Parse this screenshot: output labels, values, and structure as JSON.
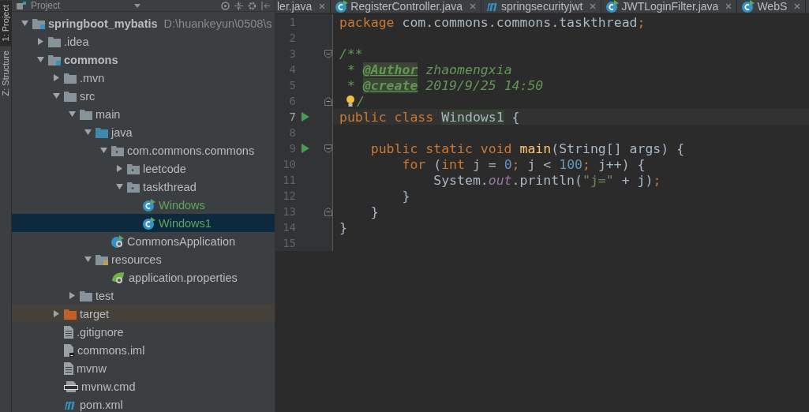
{
  "side_strip": [
    {
      "label": "1: Project",
      "selected": true
    },
    {
      "label": "Z: Structure",
      "selected": false
    }
  ],
  "project_panel": {
    "title": "Project",
    "tree": [
      {
        "label": "springboot_mybatis",
        "path": "D:\\huankeyun\\0508\\s",
        "kind": "module",
        "expanded": true,
        "selected": false,
        "color": "#bbbbbb",
        "children": [
          {
            "label": ".idea",
            "kind": "folder",
            "expanded": false,
            "selected": false,
            "color": "#bbbbbb"
          },
          {
            "label": "commons",
            "kind": "module",
            "expanded": true,
            "selected": false,
            "color": "#bbbbbb",
            "children": [
              {
                "label": ".mvn",
                "kind": "folder",
                "expanded": false,
                "selected": false,
                "color": "#bbbbbb"
              },
              {
                "label": "src",
                "kind": "folder",
                "expanded": true,
                "selected": false,
                "color": "#bbbbbb",
                "children": [
                  {
                    "label": "main",
                    "kind": "folder",
                    "expanded": true,
                    "selected": false,
                    "color": "#bbbbbb",
                    "children": [
                      {
                        "label": "java",
                        "kind": "source",
                        "expanded": true,
                        "selected": false,
                        "color": "#bbbbbb",
                        "children": [
                          {
                            "label": "com.commons.commons",
                            "kind": "package",
                            "expanded": true,
                            "selected": false,
                            "color": "#bbbbbb",
                            "children": [
                              {
                                "label": "leetcode",
                                "kind": "package",
                                "expanded": false,
                                "selected": false,
                                "color": "#bbbbbb"
                              },
                              {
                                "label": "taskthread",
                                "kind": "package",
                                "expanded": true,
                                "selected": false,
                                "color": "#bbbbbb",
                                "children": [
                                  {
                                    "label": "Windows",
                                    "kind": "class",
                                    "selected": false,
                                    "color": "#62a55c"
                                  },
                                  {
                                    "label": "Windows1",
                                    "kind": "class",
                                    "selected": true,
                                    "color": "#62a55c"
                                  }
                                ]
                              }
                            ]
                          },
                          {
                            "label": "CommonsApplication",
                            "kind": "springclass",
                            "selected": false,
                            "color": "#bbbbbb"
                          }
                        ]
                      },
                      {
                        "label": "resources",
                        "kind": "resources",
                        "expanded": true,
                        "selected": false,
                        "color": "#bbbbbb",
                        "children": [
                          {
                            "label": "application.properties",
                            "kind": "springfile",
                            "selected": false,
                            "color": "#bbbbbb"
                          }
                        ]
                      }
                    ]
                  },
                  {
                    "label": "test",
                    "kind": "folder",
                    "expanded": false,
                    "selected": false,
                    "color": "#bbbbbb"
                  }
                ]
              },
              {
                "label": "target",
                "kind": "excluded",
                "expanded": false,
                "selected": false,
                "color": "#bbbbbb"
              },
              {
                "label": ".gitignore",
                "kind": "file",
                "selected": false,
                "color": "#bbbbbb"
              },
              {
                "label": "commons.iml",
                "kind": "iml",
                "selected": false,
                "color": "#bbbbbb"
              },
              {
                "label": "mvnw",
                "kind": "file",
                "selected": false,
                "color": "#bbbbbb"
              },
              {
                "label": "mvnw.cmd",
                "kind": "cmd",
                "selected": false,
                "color": "#bbbbbb"
              },
              {
                "label": "pom.xml",
                "kind": "maven",
                "selected": false,
                "color": "#bbbbbb"
              }
            ]
          }
        ]
      }
    ]
  },
  "editor": {
    "tabs": [
      {
        "label": "ler.java",
        "kind": "plain",
        "selected": false
      },
      {
        "label": "RegisterController.java",
        "kind": "class",
        "selected": false
      },
      {
        "label": "springsecurityjwt",
        "kind": "maven",
        "selected": false
      },
      {
        "label": "JWTLoginFilter.java",
        "kind": "class",
        "selected": false
      },
      {
        "label": "WebS",
        "kind": "class",
        "selected": false
      }
    ],
    "lines": [
      {
        "number": "1",
        "run": false,
        "fold_start": false,
        "fold_end": false,
        "bulb": false,
        "current": false,
        "tokens": [
          {
            "kind": "keyword",
            "text": "package "
          },
          {
            "kind": "plain",
            "text": "com.commons.commons.taskthread"
          },
          {
            "kind": "keyword",
            "text": ";"
          }
        ]
      },
      {
        "number": "2",
        "run": false,
        "fold_start": false,
        "fold_end": false,
        "bulb": false,
        "current": false
      },
      {
        "number": "3",
        "run": false,
        "fold_start": true,
        "fold_end": false,
        "bulb": false,
        "current": false,
        "tokens": [
          {
            "kind": "comment",
            "text": "/**"
          }
        ]
      },
      {
        "number": "4",
        "run": false,
        "fold_start": false,
        "fold_end": false,
        "bulb": false,
        "current": false,
        "tokens": [
          {
            "kind": "comment",
            "text": " * "
          },
          {
            "kind": "doctag",
            "text": "@Author"
          },
          {
            "kind": "comment",
            "text": " zhaomengxia"
          }
        ]
      },
      {
        "number": "5",
        "run": false,
        "fold_start": false,
        "fold_end": false,
        "bulb": false,
        "current": false,
        "tokens": [
          {
            "kind": "comment",
            "text": " * "
          },
          {
            "kind": "doctag",
            "text": "@create"
          },
          {
            "kind": "comment",
            "text": " 2019/9/25 14:50"
          }
        ]
      },
      {
        "number": "6",
        "run": false,
        "fold_start": false,
        "fold_end": true,
        "bulb": true,
        "current": false,
        "tokens": [
          {
            "kind": "comment",
            "text": "/"
          }
        ]
      },
      {
        "number": "7",
        "run": true,
        "fold_start": false,
        "fold_end": false,
        "bulb": false,
        "current": true,
        "tokens": [
          {
            "kind": "keyword",
            "text": "public class "
          },
          {
            "kind": "usage",
            "text": "Windows1"
          },
          {
            "kind": "plain",
            "text": " {"
          }
        ]
      },
      {
        "number": "8",
        "run": false,
        "fold_start": false,
        "fold_end": false,
        "bulb": false,
        "current": false
      },
      {
        "number": "9",
        "run": true,
        "fold_start": true,
        "fold_end": false,
        "bulb": false,
        "current": false,
        "tokens": [
          {
            "kind": "keyword",
            "text": "    public static void "
          },
          {
            "kind": "method",
            "text": "main"
          },
          {
            "kind": "plain",
            "text": "(String[] args) {"
          }
        ]
      },
      {
        "number": "10",
        "run": false,
        "fold_start": false,
        "fold_end": false,
        "bulb": false,
        "current": false,
        "tokens": [
          {
            "kind": "keyword",
            "text": "        for "
          },
          {
            "kind": "plain",
            "text": "("
          },
          {
            "kind": "keyword",
            "text": "int "
          },
          {
            "kind": "plain",
            "text": "j = "
          },
          {
            "kind": "number",
            "text": "0"
          },
          {
            "kind": "keyword",
            "text": "; "
          },
          {
            "kind": "plain",
            "text": "j < "
          },
          {
            "kind": "number",
            "text": "100"
          },
          {
            "kind": "keyword",
            "text": "; "
          },
          {
            "kind": "plain",
            "text": "j++) {"
          }
        ]
      },
      {
        "number": "11",
        "run": false,
        "fold_start": false,
        "fold_end": false,
        "bulb": false,
        "current": false,
        "tokens": [
          {
            "kind": "plain",
            "text": "            System."
          },
          {
            "kind": "field",
            "text": "out"
          },
          {
            "kind": "plain",
            "text": ".println("
          },
          {
            "kind": "string",
            "text": "\"j=\""
          },
          {
            "kind": "plain",
            "text": " + j)"
          },
          {
            "kind": "keyword",
            "text": ";"
          }
        ]
      },
      {
        "number": "12",
        "run": false,
        "fold_start": false,
        "fold_end": false,
        "bulb": false,
        "current": false,
        "tokens": [
          {
            "kind": "plain",
            "text": "        }"
          }
        ]
      },
      {
        "number": "13",
        "run": false,
        "fold_start": false,
        "fold_end": true,
        "bulb": false,
        "current": false,
        "tokens": [
          {
            "kind": "plain",
            "text": "    }"
          }
        ]
      },
      {
        "number": "14",
        "run": false,
        "fold_start": false,
        "fold_end": false,
        "bulb": false,
        "current": false,
        "tokens": [
          {
            "kind": "plain",
            "text": "}"
          }
        ]
      },
      {
        "number": "15",
        "run": false,
        "fold_start": false,
        "fold_end": false,
        "bulb": false,
        "current": false
      }
    ]
  }
}
